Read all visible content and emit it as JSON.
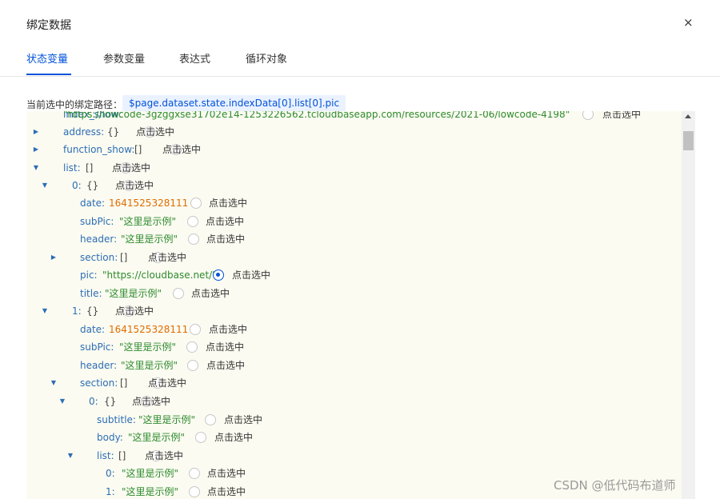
{
  "dialog": {
    "title": "绑定数据",
    "close_glyph": "×"
  },
  "tabs": [
    {
      "label": "状态变量",
      "active": true
    },
    {
      "label": "参数变量",
      "active": false
    },
    {
      "label": "表达式",
      "active": false
    },
    {
      "label": "循环对象",
      "active": false
    }
  ],
  "path": {
    "label": "当前选中的绑定路径：",
    "value": "$page.dataset.state.indexData[0].list[0].pic"
  },
  "click_select": "点击选中",
  "colors": {
    "accent": "#0052d9",
    "key": "#2c6db5",
    "string": "#2e8b2e",
    "number": "#e06c00",
    "tree_bg": "#fbfbf1"
  },
  "tree": [
    {
      "key": "index_show:",
      "value": "\"https://lowcode-3gzggxse31702e14-1253226562.tcloudbaseapp.com/resources/2021-06/lowcode-4198\"",
      "vtype": "str",
      "caret": "",
      "selected": false
    },
    {
      "key": "address:",
      "value": "{}",
      "vtype": "br",
      "caret": "collapsed",
      "selected": false
    },
    {
      "key": "function_show:",
      "value": "[]",
      "vtype": "br",
      "caret": "collapsed",
      "selected": false
    },
    {
      "key": "list:",
      "value": "[]",
      "vtype": "br",
      "caret": "expanded",
      "selected": false
    },
    {
      "key": "0:",
      "value": "{}",
      "vtype": "br",
      "caret": "expanded",
      "selected": false
    },
    {
      "key": "date:",
      "value": "1641525328111",
      "vtype": "num",
      "caret": "",
      "selected": false
    },
    {
      "key": "subPic:",
      "value": "\"这里是示例\"",
      "vtype": "str",
      "caret": "",
      "selected": false
    },
    {
      "key": "header:",
      "value": "\"这里是示例\"",
      "vtype": "str",
      "caret": "",
      "selected": false
    },
    {
      "key": "section:",
      "value": "[]",
      "vtype": "br",
      "caret": "collapsed",
      "selected": false
    },
    {
      "key": "pic:",
      "value": "\"https://cloudbase.net/\"",
      "vtype": "str",
      "caret": "",
      "selected": true
    },
    {
      "key": "title:",
      "value": "\"这里是示例\"",
      "vtype": "str",
      "caret": "",
      "selected": false
    },
    {
      "key": "1:",
      "value": "{}",
      "vtype": "br",
      "caret": "expanded",
      "selected": false
    },
    {
      "key": "date:",
      "value": "1641525328111",
      "vtype": "num",
      "caret": "",
      "selected": false
    },
    {
      "key": "subPic:",
      "value": "\"这里是示例\"",
      "vtype": "str",
      "caret": "",
      "selected": false
    },
    {
      "key": "header:",
      "value": "\"这里是示例\"",
      "vtype": "str",
      "caret": "",
      "selected": false
    },
    {
      "key": "section:",
      "value": "[]",
      "vtype": "br",
      "caret": "expanded",
      "selected": false
    },
    {
      "key": "0:",
      "value": "{}",
      "vtype": "br",
      "caret": "expanded",
      "selected": false
    },
    {
      "key": "subtitle:",
      "value": "\"这里是示例\"",
      "vtype": "str",
      "caret": "",
      "selected": false
    },
    {
      "key": "body:",
      "value": "\"这里是示例\"",
      "vtype": "str",
      "caret": "",
      "selected": false
    },
    {
      "key": "list:",
      "value": "[]",
      "vtype": "br",
      "caret": "expanded",
      "selected": false
    },
    {
      "key": "0:",
      "value": "\"这里是示例\"",
      "vtype": "str",
      "caret": "",
      "selected": false
    },
    {
      "key": "1:",
      "value": "\"这里是示例\"",
      "vtype": "str",
      "caret": "",
      "selected": false
    }
  ],
  "watermark": "CSDN @低代码布道师"
}
